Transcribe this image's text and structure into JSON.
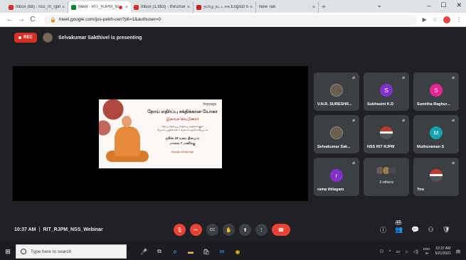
{
  "browser": {
    "tabs": [
      {
        "title": "Inbox (88) - nss_rit_rjpm@rit...",
        "fav": "#d93025",
        "active": false,
        "recording": false
      },
      {
        "title": "Meet - RIT_RJPM_NSS_W...",
        "fav": "#00832d",
        "active": true,
        "recording": true
      },
      {
        "title": "Inbox (1,983) - thirumaran...",
        "fav": "#d93025",
        "active": false,
        "recording": false
      },
      {
        "title": "தமிழ் தட்டச்சு English to ...",
        "fav": "#c5221f",
        "active": false,
        "recording": false
      },
      {
        "title": "New Tab",
        "fav": "",
        "active": false,
        "recording": false
      }
    ],
    "new_tab_glyph": "+",
    "url": "meet.google.com/jus-pekh-cen?pli=1&authuser=0",
    "controls": {
      "back": "←",
      "forward": "→",
      "reload": "C",
      "minimize": "–",
      "maximize": "☐",
      "close": "✕",
      "tab_search": "⌄"
    }
  },
  "meet": {
    "rec_label": "REC",
    "presenter_text": "Selvakumar Sakthivel is presenting",
    "slide": {
      "logo": "tinyyoga",
      "line1": "நோய் எதிர்ப்பு சக்திக்கான யோகா",
      "line2": "இலவச வெபினார்",
      "line3": "நோய் எதிர்ப்பு சக்தியை அதிகரிக்கும்",
      "line4": "யோகா பயிற்சிகள் உங்களை ஆரோக்கியமாக",
      "line5": "ஜூன் 19 வரை தினமும்",
      "line6": "மாலை 7 மணிக்கு",
      "line7": "tinyyoga.in/DailyYoga"
    },
    "participants": [
      {
        "name": "V.N.R. SURESHR...",
        "initial": "",
        "kind": "photo",
        "color": ""
      },
      {
        "name": "Subhasini K.D",
        "initial": "S",
        "kind": "letter",
        "color": "#8430ce"
      },
      {
        "name": "Sumitha Raghur...",
        "initial": "S",
        "kind": "letter",
        "color": "#e52592"
      },
      {
        "name": "Selvakumar Sak...",
        "initial": "",
        "kind": "photo",
        "color": ""
      },
      {
        "name": "NSS RIT RJPM",
        "initial": "",
        "kind": "flag",
        "color": ""
      },
      {
        "name": "Muthuraman S",
        "initial": "M",
        "kind": "letter",
        "color": "#12a4af"
      },
      {
        "name": "rama thilagam",
        "initial": "r",
        "kind": "letter",
        "color": "#8430ce"
      },
      {
        "name": "3 others",
        "initial": "",
        "kind": "others",
        "color": ""
      },
      {
        "name": "You",
        "initial": "",
        "kind": "flag",
        "color": ""
      }
    ],
    "time": "10:37 AM",
    "meeting_name": "RIT_RJPM_NSS_Webinar",
    "participant_count": "12",
    "icons": {
      "mic_off": "🎙",
      "cam_off": "⛔",
      "captions": "CC",
      "raise_hand": "✋",
      "present": "⬆",
      "more": "⋮",
      "end_call": "☎",
      "info": "ⓘ",
      "people": "👥",
      "chat": "💬",
      "activities": "⚇",
      "host": "🛡"
    }
  },
  "taskbar": {
    "search_placeholder": "Type here to search",
    "lang": [
      "ENG",
      "IN"
    ],
    "time": "10:37 AM",
    "date": "6/21/2021"
  }
}
